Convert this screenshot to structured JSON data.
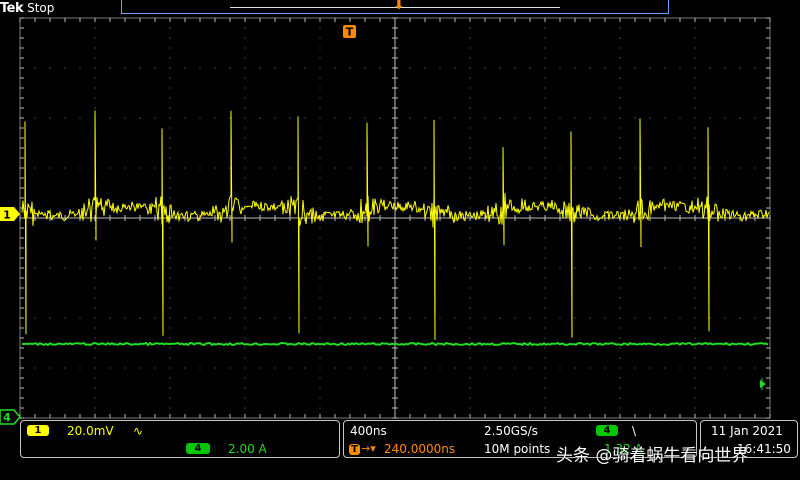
{
  "header": {
    "brand": "Tek",
    "acquisition_status": "Stop"
  },
  "trigger": {
    "marker_label": "T"
  },
  "channels": {
    "ch1": {
      "number": "1",
      "scale": "20.0mV",
      "coupling_symbol": "∿",
      "color": "#ffff00"
    },
    "ch4": {
      "number": "4",
      "scale": "2.00 A",
      "color": "#22dd22"
    }
  },
  "horizontal": {
    "time_per_div": "400ns",
    "sample_rate": "2.50GS/s",
    "trigger_position_label": "T",
    "position": "240.0000ns",
    "record_length": "10M points"
  },
  "trigger_info": {
    "source": "4",
    "slope_symbol": "\\",
    "level": "1.32 A"
  },
  "datetime": {
    "date": "11 Jan 2021",
    "time": "16:41:50"
  },
  "watermark": {
    "text": "头条 @骑着蜗牛看向世界"
  },
  "colors": {
    "ch1": "#ffff00",
    "ch4": "#22dd22",
    "trigger": "#ff8a00",
    "grid": "#8a8a8a"
  }
}
